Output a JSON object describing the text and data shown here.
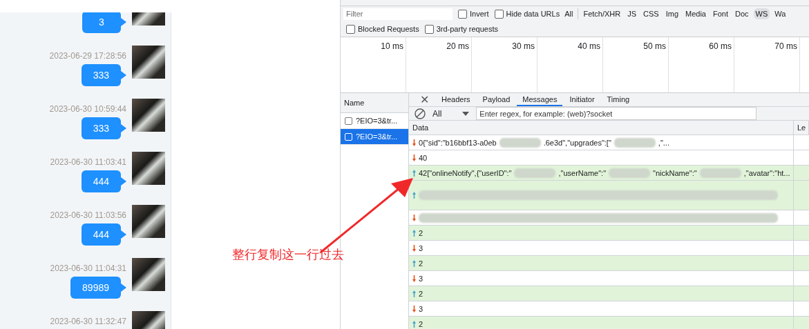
{
  "chat": {
    "messages": [
      {
        "text": "3"
      },
      {
        "time": "2023-06-29 17:28:56",
        "text": "333"
      },
      {
        "time": "2023-06-30 10:59:44",
        "text": "333"
      },
      {
        "time": "2023-06-30 11:03:41",
        "text": "444"
      },
      {
        "time": "2023-06-30 11:03:56",
        "text": "444"
      },
      {
        "time": "2023-06-30 11:04:31",
        "text": "89989"
      },
      {
        "time": "2023-06-30 11:32:47"
      }
    ]
  },
  "annotation": {
    "text": "整行复制这一行过去"
  },
  "devtools": {
    "filter": {
      "placeholder": "Filter"
    },
    "filter_checks": [
      {
        "label": "Invert",
        "checked": false
      },
      {
        "label": "Hide data URLs",
        "checked": false
      }
    ],
    "type_filters": [
      {
        "label": "All",
        "selected": false
      },
      {
        "label": "Fetch/XHR",
        "selected": false
      },
      {
        "label": "JS",
        "selected": false
      },
      {
        "label": "CSS",
        "selected": false
      },
      {
        "label": "Img",
        "selected": false
      },
      {
        "label": "Media",
        "selected": false
      },
      {
        "label": "Font",
        "selected": false
      },
      {
        "label": "Doc",
        "selected": false
      },
      {
        "label": "WS",
        "selected": true
      },
      {
        "label": "Wa",
        "selected": false
      }
    ],
    "extra_checks": [
      {
        "label": "Blocked Requests",
        "checked": false
      },
      {
        "label": "3rd-party requests",
        "checked": false
      }
    ],
    "timeline_ticks": [
      "10 ms",
      "20 ms",
      "30 ms",
      "40 ms",
      "50 ms",
      "60 ms",
      "70 ms"
    ],
    "name_column": {
      "header": "Name",
      "requests": [
        {
          "name": "?EIO=3&tr...",
          "selected": false
        },
        {
          "name": "?EIO=3&tr...",
          "selected": true
        }
      ]
    },
    "tabs": [
      {
        "label": "Headers",
        "selected": false
      },
      {
        "label": "Payload",
        "selected": false
      },
      {
        "label": "Messages",
        "selected": true
      },
      {
        "label": "Initiator",
        "selected": false
      },
      {
        "label": "Timing",
        "selected": false
      }
    ],
    "message_filter": {
      "value": "All",
      "placeholder": "Enter regex, for example: (web)?socket"
    },
    "close_icon": "✕",
    "columns": [
      "Data",
      "Le"
    ],
    "messages": [
      {
        "kind": "received",
        "segments": [
          {
            "kind": "text",
            "text": "0{\"sid\":\"b16bbf13-a0eb"
          },
          {
            "kind": "blur"
          },
          {
            "kind": "text",
            "text": ".6e3d\",\"upgrades\":[\""
          },
          {
            "kind": "blur"
          },
          {
            "kind": "text",
            "text": ",\"..."
          }
        ]
      },
      {
        "kind": "received",
        "segments": [
          {
            "kind": "text",
            "text": "40"
          }
        ]
      },
      {
        "kind": "sent",
        "segments": [
          {
            "kind": "text",
            "text": "42[\"onlineNotify\",{\"userID\":\""
          },
          {
            "kind": "blur"
          },
          {
            "kind": "text",
            "text": ",\"userName\":\""
          },
          {
            "kind": "blur"
          },
          {
            "kind": "text",
            "text": "\"nickName\":\""
          },
          {
            "kind": "blur"
          },
          {
            "kind": "text",
            "text": ",\"avatar\":\"ht..."
          }
        ]
      },
      {
        "kind": "sent",
        "segments": [
          {
            "kind": "blur"
          }
        ],
        "tall": true
      },
      {
        "kind": "received",
        "segments": [
          {
            "kind": "blur"
          }
        ]
      },
      {
        "kind": "sent",
        "segments": [
          {
            "kind": "text",
            "text": "2"
          }
        ]
      },
      {
        "kind": "received",
        "segments": [
          {
            "kind": "text",
            "text": "3"
          }
        ]
      },
      {
        "kind": "sent",
        "segments": [
          {
            "kind": "text",
            "text": "2"
          }
        ]
      },
      {
        "kind": "received",
        "segments": [
          {
            "kind": "text",
            "text": "3"
          }
        ]
      },
      {
        "kind": "sent",
        "segments": [
          {
            "kind": "text",
            "text": "2"
          }
        ]
      },
      {
        "kind": "received",
        "segments": [
          {
            "kind": "text",
            "text": "3"
          }
        ]
      },
      {
        "kind": "sent",
        "segments": [
          {
            "kind": "text",
            "text": "2"
          }
        ]
      }
    ]
  }
}
